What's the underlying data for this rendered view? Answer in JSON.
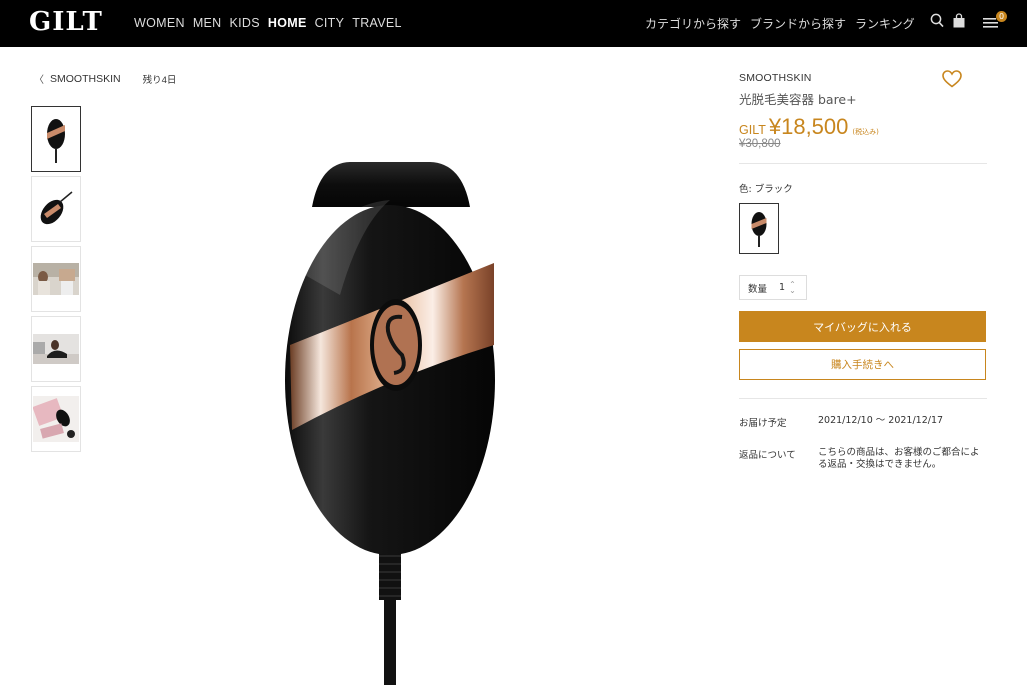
{
  "header": {
    "logo": "GILT",
    "nav": [
      {
        "label": "WOMEN",
        "active": false
      },
      {
        "label": "MEN",
        "active": false
      },
      {
        "label": "KIDS",
        "active": false
      },
      {
        "label": "HOME",
        "active": true
      },
      {
        "label": "CITY",
        "active": false
      },
      {
        "label": "TRAVEL",
        "active": false
      }
    ],
    "subnav": [
      "カテゴリから探す",
      "ブランドから探す",
      "ランキング"
    ],
    "cart_badge": "0"
  },
  "breadcrumb": {
    "brand": "SMOOTHSKIN",
    "remaining": "残り4日"
  },
  "thumbnails": [
    {
      "icon": "device-front-thumbnail",
      "selected": true
    },
    {
      "icon": "device-angle-thumbnail",
      "selected": false
    },
    {
      "icon": "lifestyle-thumbnail",
      "selected": false
    },
    {
      "icon": "model-thumbnail",
      "selected": false
    },
    {
      "icon": "package-contents-thumbnail",
      "selected": false
    }
  ],
  "product": {
    "brand": "SMOOTHSKIN",
    "name": "光脱毛美容器 bare+",
    "price_label": "GILT",
    "price": "¥18,500",
    "tax_note": "(税込み)",
    "original_price": "¥30,800",
    "color_label": "色: ブラック",
    "quantity_label": "数量",
    "quantity": "1",
    "add_to_cart": "マイバッグに入れる",
    "checkout": "購入手続きへ",
    "delivery_label": "お届け予定",
    "delivery_value": "2021/12/10 ～ 2021/12/17",
    "returns_label": "返品について",
    "returns_value": "こちらの商品は、お客様のご都合による返品・交換はできません。"
  },
  "colors": {
    "accent": "#c8861e",
    "header_bg": "#000000"
  }
}
